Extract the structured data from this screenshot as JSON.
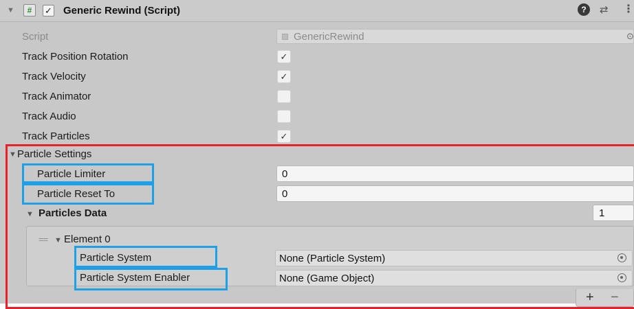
{
  "header": {
    "fold_glyph": "▼",
    "script_icon": "#",
    "enabled_check": "✓",
    "title": "Generic Rewind (Script)",
    "help_glyph": "?",
    "preset_glyph": "⇄",
    "menu_glyph": "⋮"
  },
  "script_row": {
    "label": "Script",
    "value": "GenericRewind",
    "picker_glyph": "⊙"
  },
  "toggles": [
    {
      "label": "Track Position Rotation",
      "checked": true,
      "mark": "✓"
    },
    {
      "label": "Track Velocity",
      "checked": true,
      "mark": "✓"
    },
    {
      "label": "Track Animator",
      "checked": false,
      "mark": ""
    },
    {
      "label": "Track Audio",
      "checked": false,
      "mark": ""
    },
    {
      "label": "Track Particles",
      "checked": true,
      "mark": "✓"
    }
  ],
  "particle_settings": {
    "fold_glyph": "▼",
    "label": "Particle Settings",
    "limiter": {
      "label": "Particle Limiter",
      "value": "0"
    },
    "reset_to": {
      "label": "Particle Reset To",
      "value": "0"
    },
    "particles_data": {
      "fold_glyph": "▼",
      "label": "Particles Data",
      "size": "1",
      "element": {
        "handle": "==",
        "fold_glyph": "▼",
        "label": "Element 0",
        "particle_system": {
          "label": "Particle System",
          "value": "None (Particle System)"
        },
        "enabler": {
          "label": "Particle System Enabler",
          "value": "None (Game Object)"
        }
      },
      "add_glyph": "+",
      "remove_glyph": "−"
    }
  },
  "colors": {
    "highlight_red": "#e8202a",
    "highlight_blue": "#1ea0e6",
    "panel_bg": "#c8c8c8"
  }
}
